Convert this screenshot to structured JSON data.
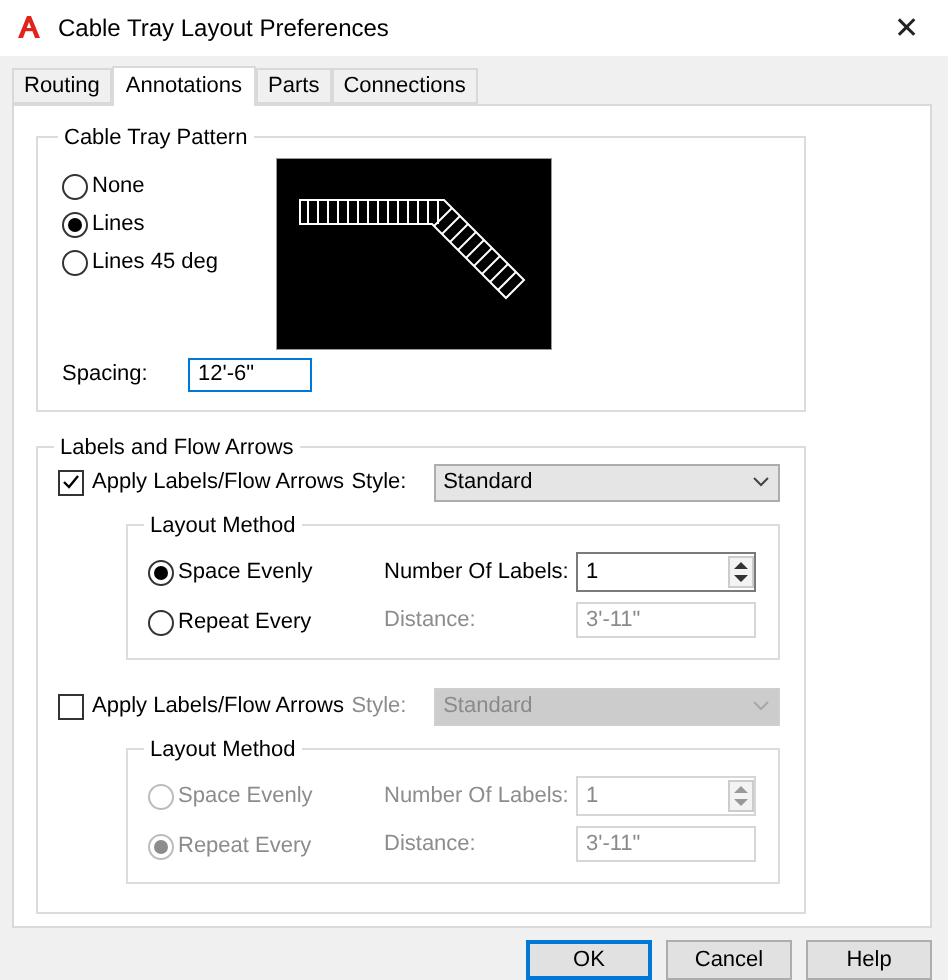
{
  "window": {
    "title": "Cable Tray Layout Preferences",
    "close": "✕"
  },
  "tabs": [
    {
      "label": "Routing",
      "selected": false
    },
    {
      "label": "Annotations",
      "selected": true
    },
    {
      "label": "Parts",
      "selected": false
    },
    {
      "label": "Connections",
      "selected": false
    }
  ],
  "pattern": {
    "title": "Cable Tray Pattern",
    "options": [
      {
        "label": "None",
        "selected": false
      },
      {
        "label": "Lines",
        "selected": true
      },
      {
        "label": "Lines 45 deg",
        "selected": false
      }
    ],
    "spacing_label": "Spacing:",
    "spacing_value": "12'-6\"",
    "spacing_focused": true
  },
  "labels": {
    "title": "Labels and Flow Arrows",
    "sets": [
      {
        "apply": {
          "label": "Apply Labels/Flow Arrows",
          "checked": true
        },
        "style_label": "Style:",
        "style_value": "Standard",
        "disabled": false,
        "layout": {
          "title": "Layout Method",
          "options": [
            {
              "label": "Space Evenly",
              "selected": true
            },
            {
              "label": "Repeat Every",
              "selected": false
            }
          ],
          "number_label": "Number Of Labels:",
          "number_value": "1",
          "distance_label": "Distance:",
          "distance_value": "3'-11\"",
          "distance_disabled": true
        }
      },
      {
        "apply": {
          "label": "Apply Labels/Flow Arrows",
          "checked": false
        },
        "style_label": "Style:",
        "style_value": "Standard",
        "disabled": true,
        "layout": {
          "title": "Layout Method",
          "options": [
            {
              "label": "Space Evenly",
              "selected": false
            },
            {
              "label": "Repeat Every",
              "selected": true
            }
          ],
          "number_label": "Number Of Labels:",
          "number_value": "1",
          "distance_label": "Distance:",
          "distance_value": "3'-11\"",
          "distance_disabled": true
        }
      }
    ]
  },
  "buttons": [
    {
      "label": "OK",
      "default": true
    },
    {
      "label": "Cancel",
      "default": false
    },
    {
      "label": "Help",
      "default": false
    }
  ]
}
